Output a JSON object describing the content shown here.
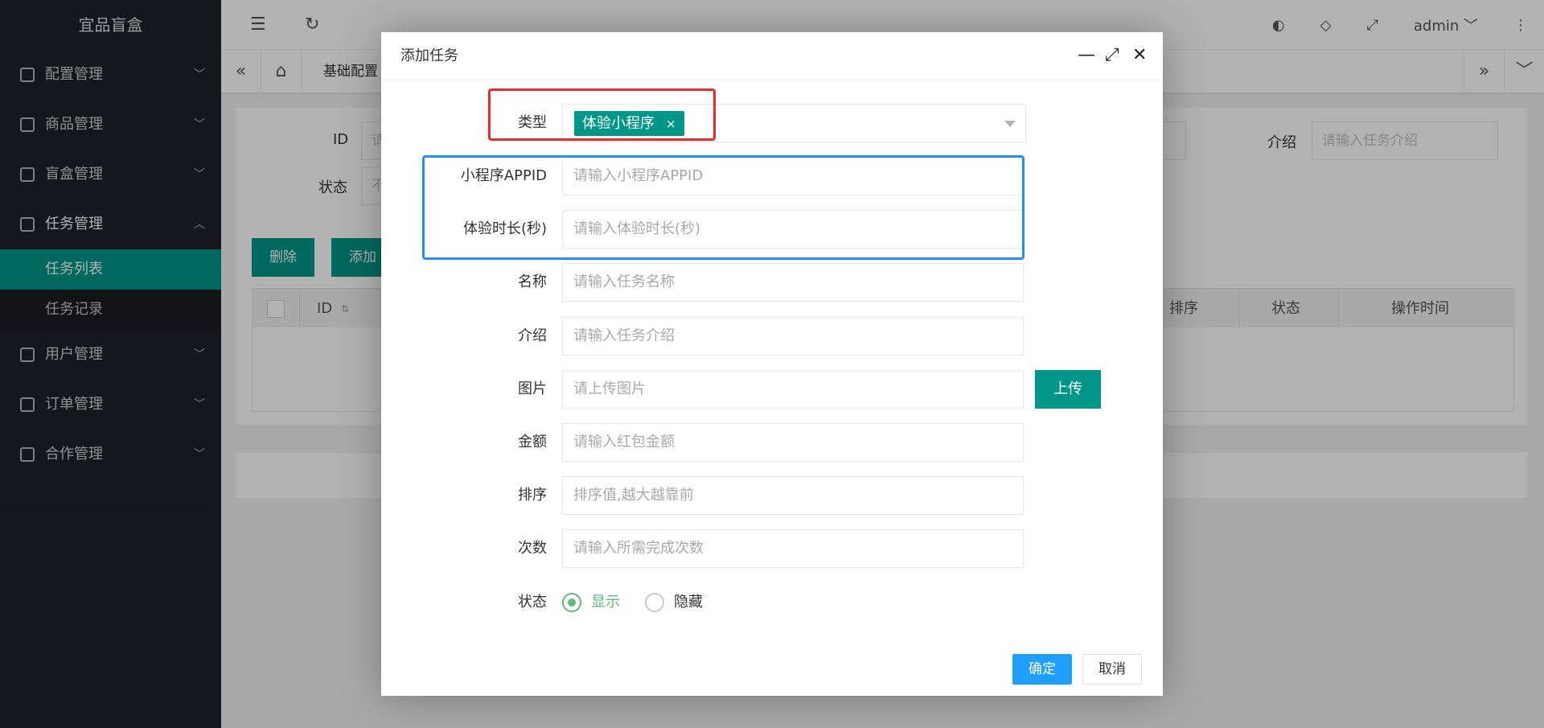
{
  "app": {
    "title": "宜品盲盒"
  },
  "sidebar": {
    "items": [
      {
        "label": "配置管理",
        "icon": "settings-icon"
      },
      {
        "label": "商品管理",
        "icon": "mail-icon"
      },
      {
        "label": "盲盒管理",
        "icon": "gift-icon"
      },
      {
        "label": "任务管理",
        "icon": "clipboard-icon"
      },
      {
        "label": "用户管理",
        "icon": "user-icon"
      },
      {
        "label": "订单管理",
        "icon": "document-icon"
      },
      {
        "label": "合作管理",
        "icon": "cooperate-icon"
      }
    ],
    "sub_items": [
      {
        "label": "任务列表",
        "active": true
      },
      {
        "label": "任务记录",
        "active": false
      }
    ]
  },
  "header": {
    "user": "admin"
  },
  "tabs": {
    "current": "基础配置"
  },
  "background": {
    "filters": [
      {
        "label": "ID",
        "placeholder": "请"
      },
      {
        "label": "状态",
        "placeholder": "不"
      },
      {
        "label": "介绍",
        "placeholder": "请输入任务介绍"
      }
    ],
    "buttons": {
      "delete": "删除",
      "add": "添加"
    },
    "table_headers": [
      "ID",
      "排序",
      "状态",
      "操作时间"
    ]
  },
  "modal": {
    "title": "添加任务",
    "type_label": "类型",
    "type_tag": "体验小程序",
    "tag_remove": "×",
    "fields": [
      {
        "label": "小程序APPID",
        "placeholder": "请输入小程序APPID"
      },
      {
        "label": "体验时长(秒)",
        "placeholder": "请输入体验时长(秒)"
      },
      {
        "label": "名称",
        "placeholder": "请输入任务名称"
      },
      {
        "label": "介绍",
        "placeholder": "请输入任务介绍"
      },
      {
        "label": "图片",
        "placeholder": "请上传图片"
      },
      {
        "label": "金额",
        "placeholder": "请输入红包金额"
      },
      {
        "label": "排序",
        "placeholder": "排序值,越大越靠前"
      },
      {
        "label": "次数",
        "placeholder": "请输入所需完成次数"
      }
    ],
    "upload_label": "上传",
    "status_label": "状态",
    "status_options": [
      {
        "label": "显示",
        "checked": true
      },
      {
        "label": "隐藏",
        "checked": false
      }
    ],
    "ok_label": "确定",
    "cancel_label": "取消"
  },
  "colors": {
    "primary": "#009688",
    "confirm": "#1e9fff",
    "highlight_red": "#f0282d",
    "highlight_blue": "#1e90ff",
    "radio": "#5fb878"
  }
}
